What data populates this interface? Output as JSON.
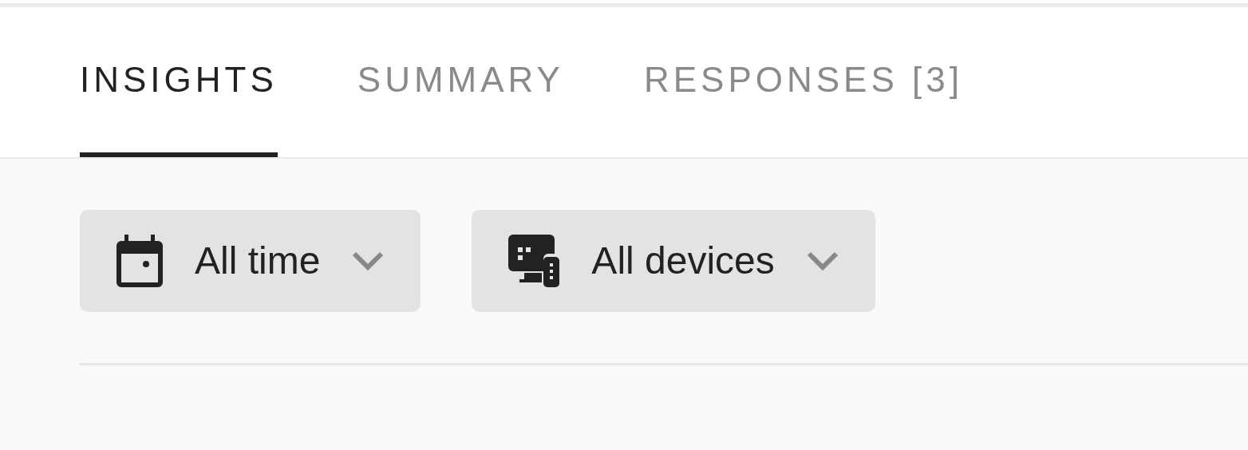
{
  "tabs": [
    {
      "label": "INSIGHTS",
      "selected": true
    },
    {
      "label": "SUMMARY",
      "selected": false
    },
    {
      "label": "RESPONSES [3]",
      "selected": false
    }
  ],
  "filters": [
    {
      "kind": "date",
      "label": "All time"
    },
    {
      "kind": "device",
      "label": "All devices"
    }
  ]
}
